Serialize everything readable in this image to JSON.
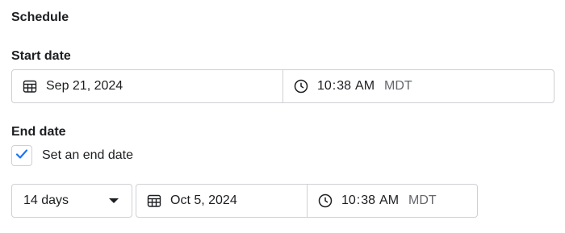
{
  "section": {
    "title": "Schedule"
  },
  "start": {
    "label": "Start date",
    "date": "Sep 21, 2024",
    "time_hour": "10",
    "time_minute": "38",
    "time_ampm": "AM",
    "timezone": "MDT"
  },
  "end": {
    "label": "End date",
    "checkbox_label": "Set an end date",
    "checkbox_checked": true,
    "duration": "14 days",
    "date": "Oct 5, 2024",
    "time_hour": "10",
    "time_minute": "38",
    "time_ampm": "AM",
    "timezone": "MDT"
  },
  "icons": {
    "calendar": "calendar-icon",
    "clock": "clock-icon",
    "check": "checkmark-icon",
    "caret": "caret-down-icon"
  },
  "colors": {
    "text": "#1c1e21",
    "muted": "#65676b",
    "border": "#ced0d4",
    "accent": "#1877f2"
  }
}
